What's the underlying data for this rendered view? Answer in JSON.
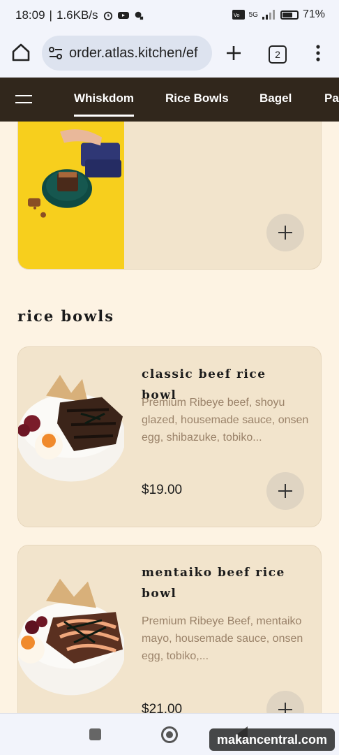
{
  "status_bar": {
    "time": "18:09",
    "speed": "1.6KB/s",
    "network": "5G",
    "battery": "71%",
    "battery_level": 0.71
  },
  "browser": {
    "url": "order.atlas.kitchen/ef",
    "tab_count": "2"
  },
  "nav": {
    "tabs": [
      {
        "label": "Whiskdom",
        "active": true
      },
      {
        "label": "Rice Bowls",
        "active": false
      },
      {
        "label": "Bagel",
        "active": false
      },
      {
        "label": "Pa",
        "active": false
      }
    ]
  },
  "previous_item": {
    "title_fragment": "brownies"
  },
  "section": {
    "title": "rice bowls"
  },
  "items": [
    {
      "title": "classic beef rice bowl",
      "description": "Premium Ribeye beef, shoyu glazed, housemade sauce, onsen egg, shibazuke, tobiko...",
      "price": "$19.00"
    },
    {
      "title": "mentaiko beef rice bowl",
      "description": "Premium Ribeye Beef, mentaiko mayo, housemade sauce, onsen egg, tobiko,...",
      "price": "$21.00"
    }
  ],
  "watermark": "makancentral.com",
  "colors": {
    "background": "#fdf3e3",
    "card": "#f2e4cc",
    "nav": "#31271c",
    "description": "#9a8269"
  }
}
